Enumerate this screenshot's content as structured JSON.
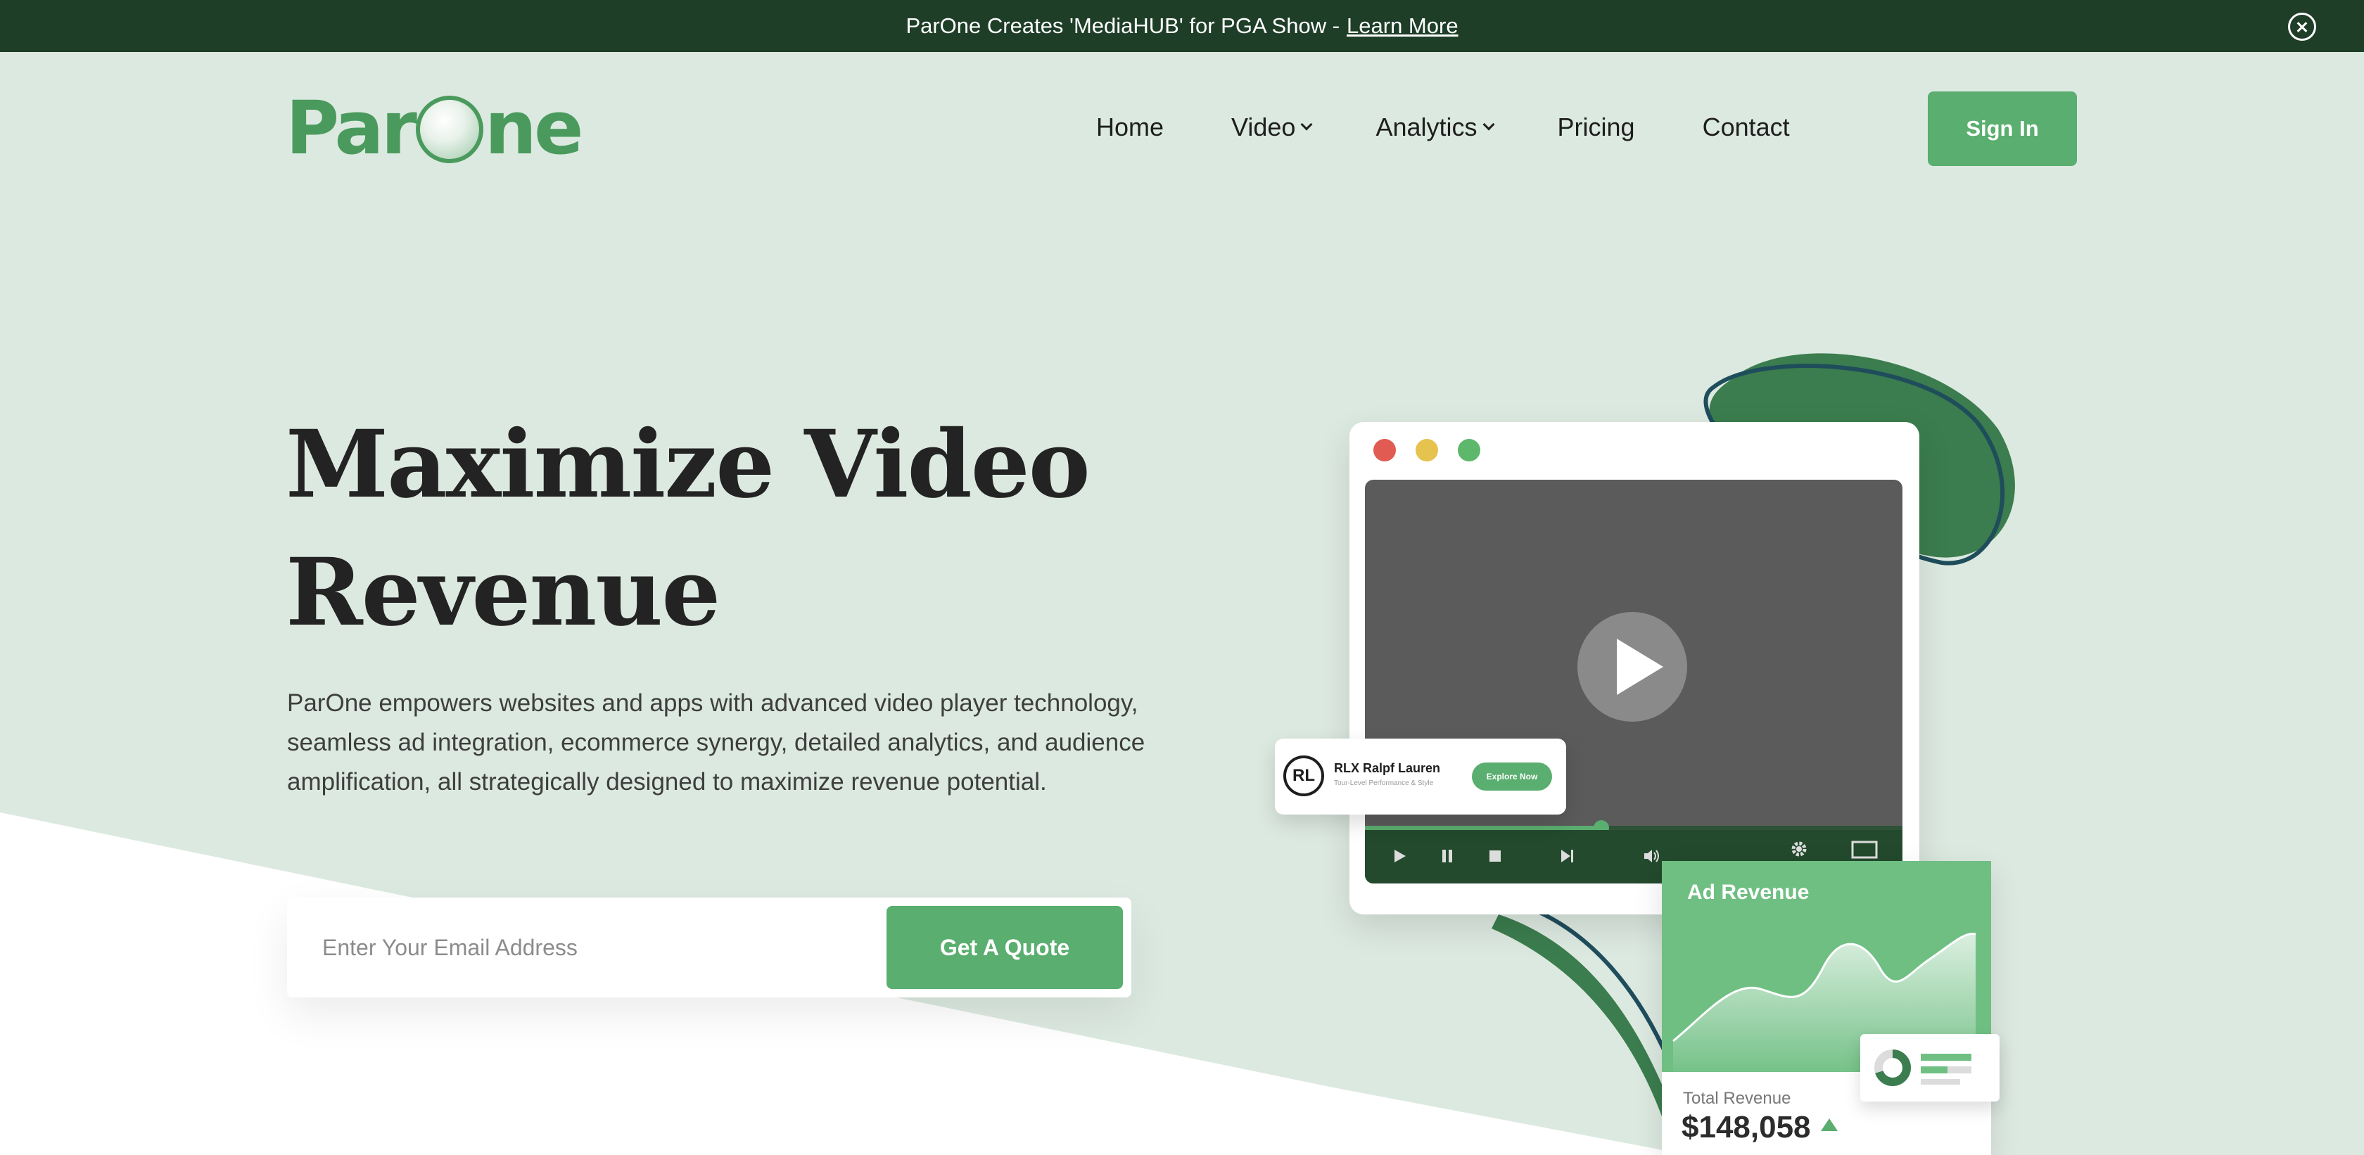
{
  "announcement": {
    "text": "ParOne Creates 'MediaHUB' for PGA Show - ",
    "link": "Learn More"
  },
  "header": {
    "logo_prefix": "Par",
    "logo_suffix": "ne",
    "nav": [
      {
        "label": "Home",
        "has_dropdown": false
      },
      {
        "label": "Video",
        "has_dropdown": true
      },
      {
        "label": "Analytics",
        "has_dropdown": true
      },
      {
        "label": "Pricing",
        "has_dropdown": false
      },
      {
        "label": "Contact",
        "has_dropdown": false
      }
    ],
    "signin_label": "Sign In"
  },
  "hero": {
    "title_line1": "Maximize Video",
    "title_line2": "Revenue",
    "description": "ParOne empowers websites and apps with advanced video player technology, seamless ad integration, ecommerce synergy, detailed analytics, and audience amplification, all strategically designed to maximize revenue potential.",
    "email_placeholder": "Enter Your Email Address",
    "quote_label": "Get A Quote"
  },
  "illustration": {
    "brand_logo": "RL",
    "brand_name": "RLX Ralpf Lauren",
    "brand_tagline": "Tour-Level Performance & Style",
    "explore_label": "Explore Now",
    "video_progress": 0.44,
    "revenue_title": "Ad Revenue",
    "revenue_label": "Total Revenue",
    "revenue_value": "$148,058"
  },
  "colors": {
    "brand_green": "#5aae6f",
    "dark_green": "#1f3e28",
    "hero_bg": "#dce9e0",
    "window_red": "#e15b53",
    "window_yellow": "#e6c24f",
    "window_green": "#5db86c"
  }
}
